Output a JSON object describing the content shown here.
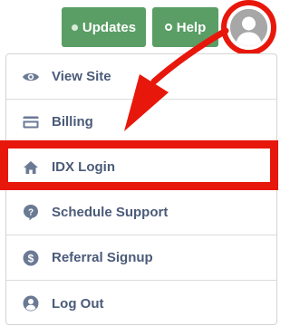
{
  "header": {
    "updates_label": "Updates",
    "help_label": "Help"
  },
  "menu": {
    "items": [
      {
        "label": "View Site",
        "icon": "eye-icon"
      },
      {
        "label": "Billing",
        "icon": "credit-card-icon"
      },
      {
        "label": "IDX Login",
        "icon": "home-icon"
      },
      {
        "label": "Schedule Support",
        "icon": "question-bubble-icon"
      },
      {
        "label": "Referral Signup",
        "icon": "dollar-circle-icon"
      },
      {
        "label": "Log Out",
        "icon": "user-circle-icon"
      }
    ]
  },
  "colors": {
    "button_green": "#5a9e65",
    "annotation_red": "#e8170b",
    "menu_text": "#4b5b79",
    "menu_icon": "#6b7a94"
  }
}
